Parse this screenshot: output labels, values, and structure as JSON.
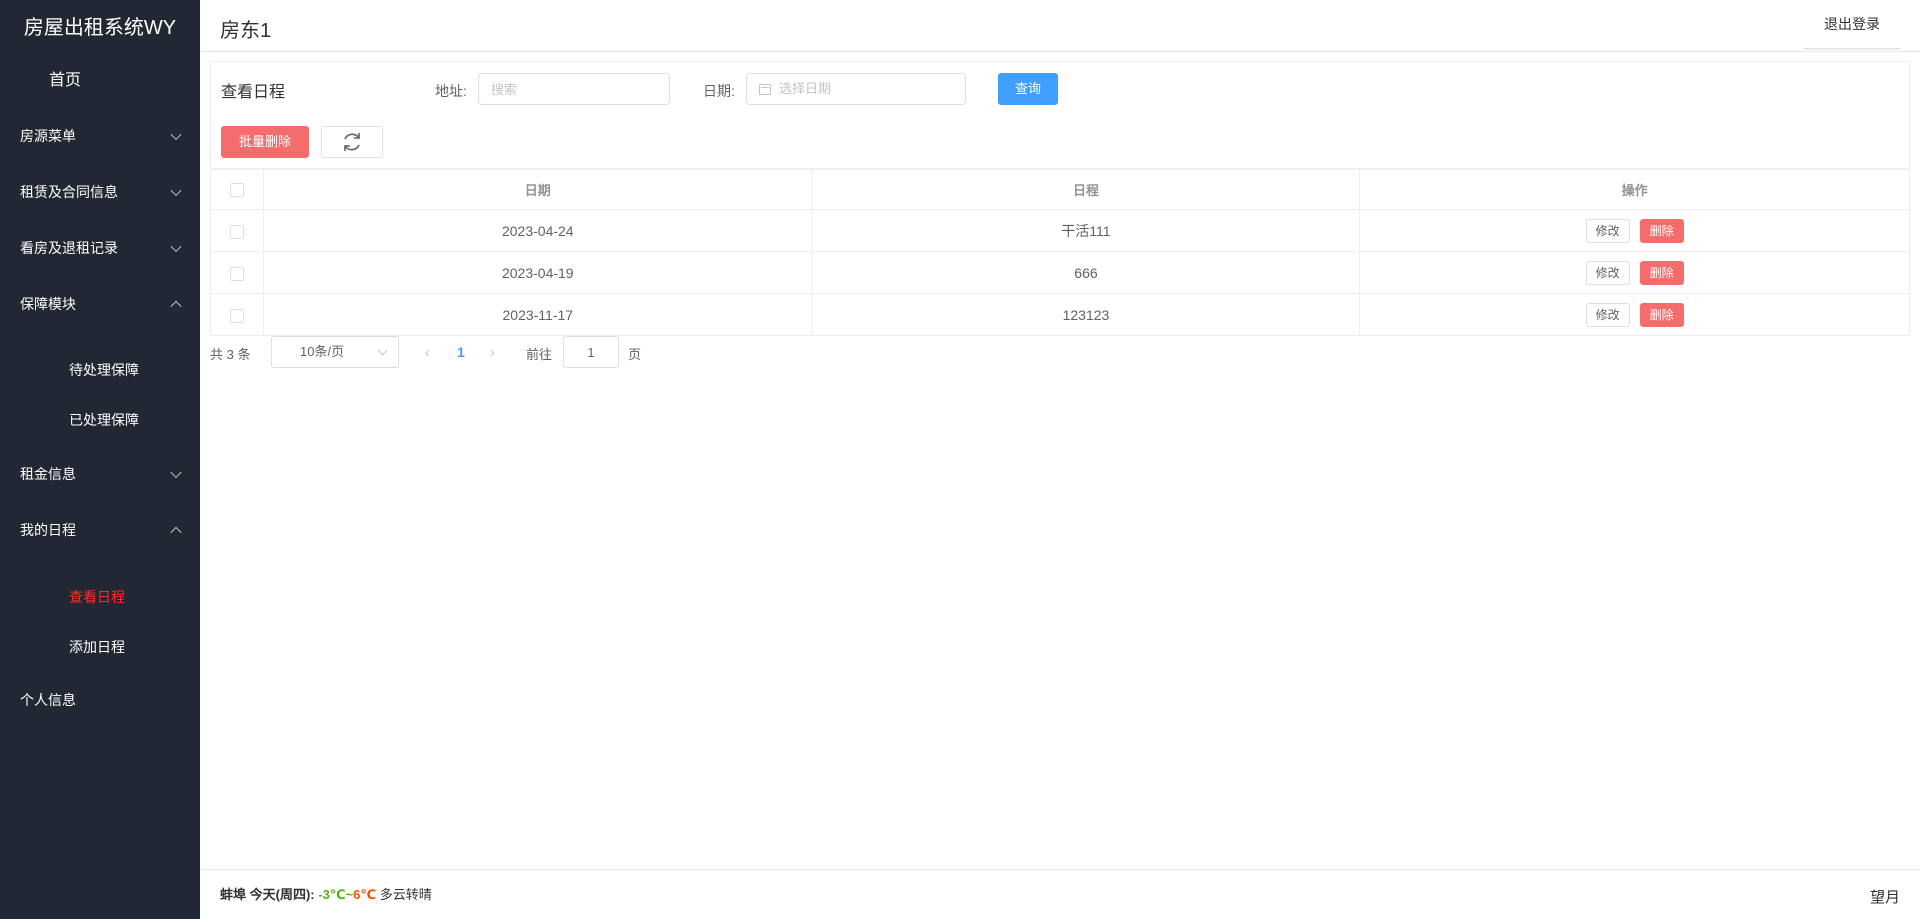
{
  "app": {
    "title": "房屋出租系统WY",
    "home": "首页"
  },
  "sidebar": {
    "items": [
      {
        "label": "房源菜单"
      },
      {
        "label": "租赁及合同信息"
      },
      {
        "label": "看房及退租记录"
      },
      {
        "label": "保障模块"
      },
      {
        "label": "租金信息"
      },
      {
        "label": "我的日程"
      },
      {
        "label": "个人信息"
      }
    ],
    "sub_guarantee": [
      {
        "label": "待处理保障"
      },
      {
        "label": "已处理保障"
      }
    ],
    "sub_schedule": [
      {
        "label": "查看日程"
      },
      {
        "label": "添加日程"
      }
    ]
  },
  "header": {
    "user": "房东1",
    "logout": "退出登录"
  },
  "search": {
    "panel_title": "查看日程",
    "address_label": "地址:",
    "address_placeholder": "搜索",
    "date_label": "日期:",
    "date_placeholder": "选择日期",
    "query_button": "查询",
    "batch_delete": "批量删除",
    "refresh_icon": "refresh-icon"
  },
  "table": {
    "headers": [
      "日期",
      "日程",
      "操作"
    ],
    "rows": [
      {
        "date": "2023-04-24",
        "schedule": "干活111"
      },
      {
        "date": "2023-04-19",
        "schedule": "666"
      },
      {
        "date": "2023-11-17",
        "schedule": "123123"
      }
    ],
    "edit_label": "修改",
    "delete_label": "删除"
  },
  "pagination": {
    "total": "共 3 条",
    "page_size": "10条/页",
    "current_page": "1",
    "goto_label": "前往",
    "goto_value": "1",
    "page_unit": "页"
  },
  "footer": {
    "city": "蚌埠",
    "day": "今天(周四):",
    "temp_low": "-3℃",
    "tilde": "~",
    "temp_high": "6℃",
    "condition": "多云转晴",
    "moon_phase": "望月"
  },
  "colors": {
    "sidebar_bg": "#212833",
    "primary": "#409eff",
    "danger": "#f56c6c",
    "active_menu": "#ff2b2b"
  }
}
